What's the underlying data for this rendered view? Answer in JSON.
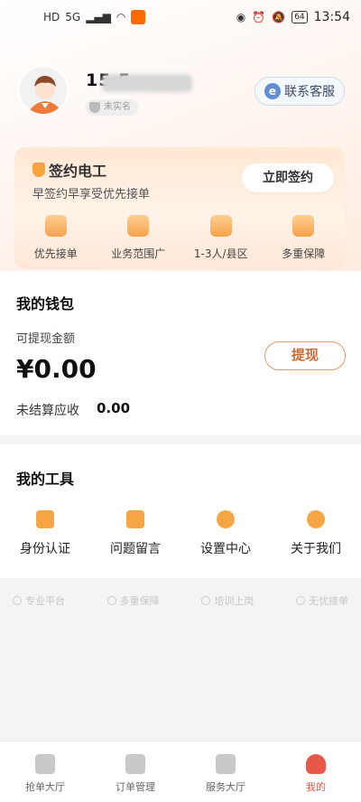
{
  "status_bar": {
    "left_icons": [
      "HD",
      "5G",
      "signal",
      "wifi"
    ],
    "time": "13:54",
    "battery": "64"
  },
  "profile": {
    "phone_visible": "15      5",
    "realname_badge": "未实名",
    "service_button": "联系客服"
  },
  "sign_card": {
    "title": "签约电工",
    "subtitle": "早签约早享受优先接单",
    "button": "立即签约",
    "benefits": [
      "优先接单",
      "业务范围广",
      "1-3人/县区",
      "多重保障"
    ]
  },
  "wallet": {
    "title": "我的钱包",
    "withdrawable_label": "可提现金额",
    "amount": "¥0.00",
    "withdraw_button": "提现",
    "pending_label": "未结算应收",
    "pending_value": "0.00"
  },
  "tools": {
    "title": "我的工具",
    "items": [
      "身份认证",
      "问题留言",
      "设置中心",
      "关于我们"
    ]
  },
  "features": [
    "专业平台",
    "多重保障",
    "培训上岗",
    "无忧接单"
  ],
  "bottom_nav": {
    "items": [
      "抢单大厅",
      "订单管理",
      "服务大厅",
      "我的"
    ],
    "active": "我的"
  },
  "colors": {
    "accent_orange": "#f6a545",
    "active_red": "#e8584a",
    "withdraw_border": "#e79a6a"
  }
}
